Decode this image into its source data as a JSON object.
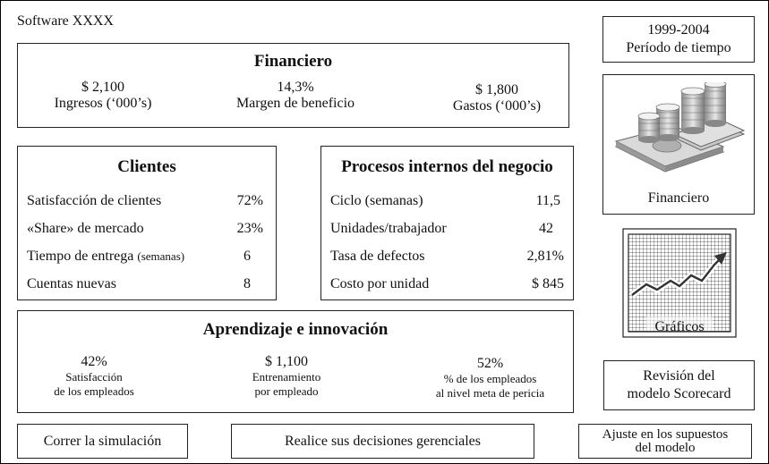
{
  "app": {
    "title": "Software XXXX"
  },
  "period": {
    "years": "1999-2004",
    "label": "Período de tiempo"
  },
  "financiero": {
    "title": "Financiero",
    "metrics": [
      {
        "value": "$ 2,100",
        "label": "Ingresos (‘000’s)"
      },
      {
        "value": "14,3%",
        "label": "Margen de beneficio"
      },
      {
        "value": "$ 1,800",
        "label": "Gastos (‘000’s)"
      }
    ]
  },
  "clientes": {
    "title": "Clientes",
    "rows": [
      {
        "label": "Satisfacción de clientes",
        "value": "72%"
      },
      {
        "label": "«Share» de mercado",
        "value": "23%"
      },
      {
        "label": "Tiempo de entrega",
        "sub": "(semanas)",
        "value": "6"
      },
      {
        "label": "Cuentas nuevas",
        "value": "8"
      }
    ]
  },
  "procesos": {
    "title": "Procesos internos del negocio",
    "rows": [
      {
        "label": "Ciclo (semanas)",
        "value": "11,5"
      },
      {
        "label": "Unidades/trabajador",
        "value": "42"
      },
      {
        "label": "Tasa de defectos",
        "value": "2,81%"
      },
      {
        "label": "Costo por unidad",
        "value": "$ 845"
      }
    ]
  },
  "aprendizaje": {
    "title": "Aprendizaje e innovación",
    "metrics": [
      {
        "value": "42%",
        "label1": "Satisfacción",
        "label2": "de los empleados"
      },
      {
        "value": "$ 1,100",
        "label1": "Entrenamiento",
        "label2": "por empleado"
      },
      {
        "value": "52%",
        "label1": "% de los empleados",
        "label2": "al nivel meta de pericia"
      }
    ]
  },
  "sidebar": {
    "financiero_label": "Financiero",
    "graficos_label": "Gráficos",
    "revision_line1": "Revisión del",
    "revision_line2": "modelo Scorecard",
    "icons": {
      "money": "money-stack-icon",
      "chart": "chart-grid-icon"
    }
  },
  "buttons": {
    "run": "Correr la simulación",
    "decisions": "Realice sus decisiones gerenciales",
    "adjust_line1": "Ajuste en los supuestos",
    "adjust_line2": "del modelo"
  }
}
